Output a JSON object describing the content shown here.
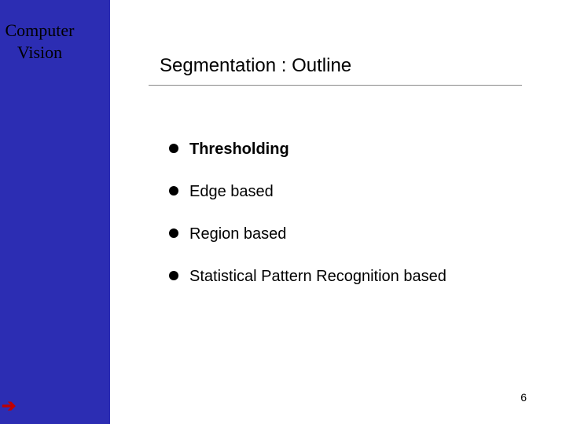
{
  "sidebar": {
    "title_line1": "Computer",
    "title_line2": "Vision"
  },
  "slide": {
    "title": "Segmentation : Outline"
  },
  "bullets": [
    {
      "text": "Thresholding",
      "bold": true
    },
    {
      "text": "Edge based",
      "bold": false
    },
    {
      "text": "Region based",
      "bold": false
    },
    {
      "text": "Statistical Pattern Recognition based",
      "bold": false
    }
  ],
  "page_number": "6",
  "arrow_glyph": "➔"
}
